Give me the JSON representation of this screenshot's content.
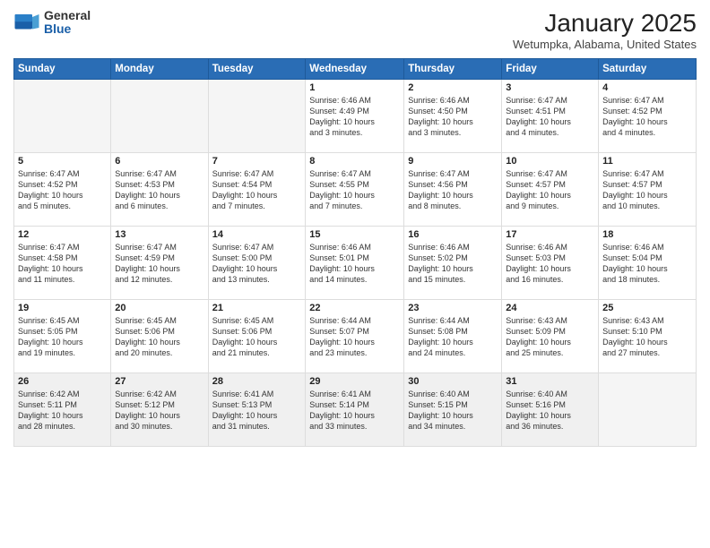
{
  "header": {
    "logo_general": "General",
    "logo_blue": "Blue",
    "month_title": "January 2025",
    "location": "Wetumpka, Alabama, United States"
  },
  "weekdays": [
    "Sunday",
    "Monday",
    "Tuesday",
    "Wednesday",
    "Thursday",
    "Friday",
    "Saturday"
  ],
  "weeks": [
    [
      {
        "day": "",
        "info": ""
      },
      {
        "day": "",
        "info": ""
      },
      {
        "day": "",
        "info": ""
      },
      {
        "day": "1",
        "info": "Sunrise: 6:46 AM\nSunset: 4:49 PM\nDaylight: 10 hours\nand 3 minutes."
      },
      {
        "day": "2",
        "info": "Sunrise: 6:46 AM\nSunset: 4:50 PM\nDaylight: 10 hours\nand 3 minutes."
      },
      {
        "day": "3",
        "info": "Sunrise: 6:47 AM\nSunset: 4:51 PM\nDaylight: 10 hours\nand 4 minutes."
      },
      {
        "day": "4",
        "info": "Sunrise: 6:47 AM\nSunset: 4:52 PM\nDaylight: 10 hours\nand 4 minutes."
      }
    ],
    [
      {
        "day": "5",
        "info": "Sunrise: 6:47 AM\nSunset: 4:52 PM\nDaylight: 10 hours\nand 5 minutes."
      },
      {
        "day": "6",
        "info": "Sunrise: 6:47 AM\nSunset: 4:53 PM\nDaylight: 10 hours\nand 6 minutes."
      },
      {
        "day": "7",
        "info": "Sunrise: 6:47 AM\nSunset: 4:54 PM\nDaylight: 10 hours\nand 7 minutes."
      },
      {
        "day": "8",
        "info": "Sunrise: 6:47 AM\nSunset: 4:55 PM\nDaylight: 10 hours\nand 7 minutes."
      },
      {
        "day": "9",
        "info": "Sunrise: 6:47 AM\nSunset: 4:56 PM\nDaylight: 10 hours\nand 8 minutes."
      },
      {
        "day": "10",
        "info": "Sunrise: 6:47 AM\nSunset: 4:57 PM\nDaylight: 10 hours\nand 9 minutes."
      },
      {
        "day": "11",
        "info": "Sunrise: 6:47 AM\nSunset: 4:57 PM\nDaylight: 10 hours\nand 10 minutes."
      }
    ],
    [
      {
        "day": "12",
        "info": "Sunrise: 6:47 AM\nSunset: 4:58 PM\nDaylight: 10 hours\nand 11 minutes."
      },
      {
        "day": "13",
        "info": "Sunrise: 6:47 AM\nSunset: 4:59 PM\nDaylight: 10 hours\nand 12 minutes."
      },
      {
        "day": "14",
        "info": "Sunrise: 6:47 AM\nSunset: 5:00 PM\nDaylight: 10 hours\nand 13 minutes."
      },
      {
        "day": "15",
        "info": "Sunrise: 6:46 AM\nSunset: 5:01 PM\nDaylight: 10 hours\nand 14 minutes."
      },
      {
        "day": "16",
        "info": "Sunrise: 6:46 AM\nSunset: 5:02 PM\nDaylight: 10 hours\nand 15 minutes."
      },
      {
        "day": "17",
        "info": "Sunrise: 6:46 AM\nSunset: 5:03 PM\nDaylight: 10 hours\nand 16 minutes."
      },
      {
        "day": "18",
        "info": "Sunrise: 6:46 AM\nSunset: 5:04 PM\nDaylight: 10 hours\nand 18 minutes."
      }
    ],
    [
      {
        "day": "19",
        "info": "Sunrise: 6:45 AM\nSunset: 5:05 PM\nDaylight: 10 hours\nand 19 minutes."
      },
      {
        "day": "20",
        "info": "Sunrise: 6:45 AM\nSunset: 5:06 PM\nDaylight: 10 hours\nand 20 minutes."
      },
      {
        "day": "21",
        "info": "Sunrise: 6:45 AM\nSunset: 5:06 PM\nDaylight: 10 hours\nand 21 minutes."
      },
      {
        "day": "22",
        "info": "Sunrise: 6:44 AM\nSunset: 5:07 PM\nDaylight: 10 hours\nand 23 minutes."
      },
      {
        "day": "23",
        "info": "Sunrise: 6:44 AM\nSunset: 5:08 PM\nDaylight: 10 hours\nand 24 minutes."
      },
      {
        "day": "24",
        "info": "Sunrise: 6:43 AM\nSunset: 5:09 PM\nDaylight: 10 hours\nand 25 minutes."
      },
      {
        "day": "25",
        "info": "Sunrise: 6:43 AM\nSunset: 5:10 PM\nDaylight: 10 hours\nand 27 minutes."
      }
    ],
    [
      {
        "day": "26",
        "info": "Sunrise: 6:42 AM\nSunset: 5:11 PM\nDaylight: 10 hours\nand 28 minutes."
      },
      {
        "day": "27",
        "info": "Sunrise: 6:42 AM\nSunset: 5:12 PM\nDaylight: 10 hours\nand 30 minutes."
      },
      {
        "day": "28",
        "info": "Sunrise: 6:41 AM\nSunset: 5:13 PM\nDaylight: 10 hours\nand 31 minutes."
      },
      {
        "day": "29",
        "info": "Sunrise: 6:41 AM\nSunset: 5:14 PM\nDaylight: 10 hours\nand 33 minutes."
      },
      {
        "day": "30",
        "info": "Sunrise: 6:40 AM\nSunset: 5:15 PM\nDaylight: 10 hours\nand 34 minutes."
      },
      {
        "day": "31",
        "info": "Sunrise: 6:40 AM\nSunset: 5:16 PM\nDaylight: 10 hours\nand 36 minutes."
      },
      {
        "day": "",
        "info": ""
      }
    ]
  ]
}
